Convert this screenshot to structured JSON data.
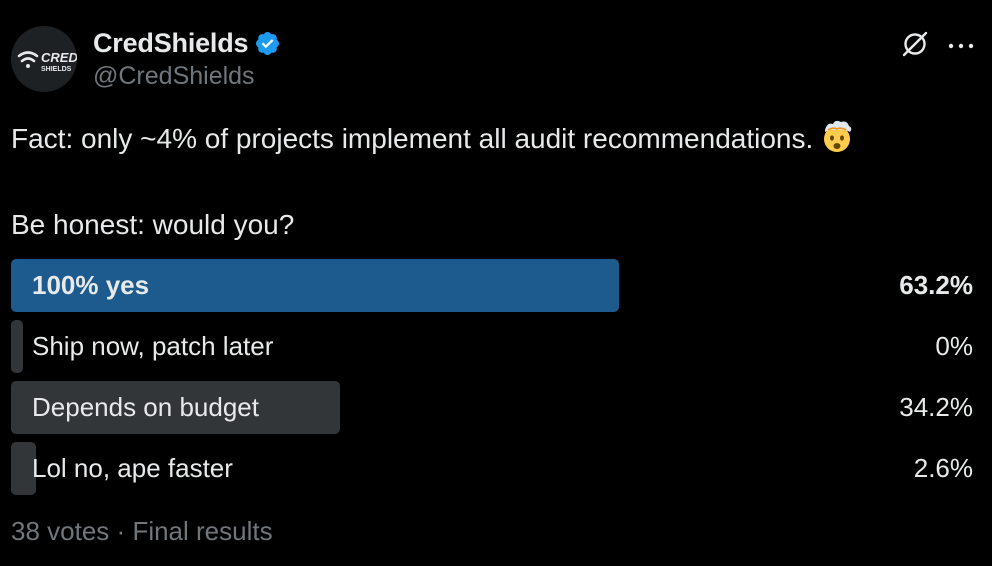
{
  "account": {
    "display_name": "CredShields",
    "handle": "@CredShields",
    "verified": true,
    "avatar_icon": "credshields-logo",
    "avatar_text_line1": "CRED",
    "avatar_text_line2": "SHIELDS"
  },
  "tweet": {
    "text_line1": "Fact: only ~4% of projects implement all audit recommendations.",
    "emoji": "exploding-head-emoji",
    "text_line2": "Be honest: would you?"
  },
  "poll": {
    "options": [
      {
        "label": "100% yes",
        "percent_text": "63.2%",
        "percent": 63.2,
        "winner": true
      },
      {
        "label": "Ship now, patch later",
        "percent_text": "0%",
        "percent": 0,
        "winner": false
      },
      {
        "label": "Depends on budget",
        "percent_text": "34.2%",
        "percent": 34.2,
        "winner": false
      },
      {
        "label": "Lol no, ape faster",
        "percent_text": "2.6%",
        "percent": 2.6,
        "winner": false
      }
    ],
    "votes": "38 votes",
    "separator": "·",
    "status": "Final results"
  },
  "colors": {
    "background": "#000000",
    "text": "#e7e9ea",
    "muted": "#71767b",
    "winner_bar": "#1d5b8f",
    "bar": "#333639",
    "verified": "#1d9bf0"
  },
  "icons": {
    "grok": "grok-icon",
    "more": "more-icon",
    "verified": "verified-badge-icon"
  }
}
